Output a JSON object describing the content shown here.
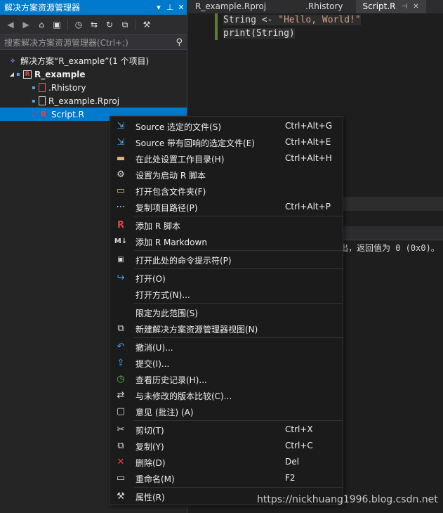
{
  "solution_explorer": {
    "title": "解决方案资源管理器",
    "title_controls": [
      "▾",
      "⊥",
      "✕"
    ],
    "search_placeholder": "搜索解决方案资源管理器(Ctrl+;)",
    "tree": {
      "solution": "解决方案“R_example”(1 个项目)",
      "project": "R_example",
      "files": [
        ".Rhistory",
        "R_example.Rproj",
        "Script.R"
      ]
    }
  },
  "editor": {
    "tabs": [
      "R_example.Rproj",
      ".Rhistory",
      "Script.R"
    ],
    "active_tab": "Script.R",
    "code": {
      "line1_prefix": "String <- ",
      "line1_string": "\"Hello, World!\"",
      "line2": "print(String)"
    }
  },
  "output": {
    "text": "出，返回值为 0 (0x0)。"
  },
  "context_menu": {
    "items": [
      {
        "label": "Source 选定的文件(S)",
        "shortcut": "Ctrl+Alt+G",
        "icon": "source-icon"
      },
      {
        "label": "Source 带有回响的选定文件(E)",
        "shortcut": "Ctrl+Alt+E",
        "icon": "source-echo-icon"
      },
      {
        "label": "在此处设置工作目录(H)",
        "shortcut": "Ctrl+Alt+H",
        "icon": "folder-icon"
      },
      {
        "label": "设置为启动 R 脚本",
        "shortcut": "",
        "icon": "gear-icon"
      },
      {
        "label": "打开包含文件夹(F)",
        "shortcut": "",
        "icon": "open-folder-icon"
      },
      {
        "label": "复制项目路径(P)",
        "shortcut": "Ctrl+Alt+P",
        "icon": "path-icon"
      },
      {
        "label": "添加 R 脚本",
        "shortcut": "",
        "icon": "r-script-icon"
      },
      {
        "label": "添加 R Markdown",
        "shortcut": "",
        "icon": "markdown-icon"
      },
      {
        "label": "打开此处的命令提示符(P)",
        "shortcut": "",
        "icon": "console-icon"
      },
      {
        "label": "打开(O)",
        "shortcut": "",
        "icon": "open-icon"
      },
      {
        "label": "打开方式(N)...",
        "shortcut": "",
        "icon": ""
      },
      {
        "label": "限定为此范围(S)",
        "shortcut": "",
        "icon": ""
      },
      {
        "label": "新建解决方案资源管理器视图(N)",
        "shortcut": "",
        "icon": "new-view-icon"
      },
      {
        "label": "撤消(U)...",
        "shortcut": "",
        "icon": "undo-icon"
      },
      {
        "label": "提交(I)...",
        "shortcut": "",
        "icon": "commit-icon"
      },
      {
        "label": "查看历史记录(H)...",
        "shortcut": "",
        "icon": "history-icon"
      },
      {
        "label": "与未修改的版本比较(C)...",
        "shortcut": "",
        "icon": "compare-icon"
      },
      {
        "label": "意见 (批注) (A)",
        "shortcut": "",
        "icon": "comment-icon"
      },
      {
        "label": "剪切(T)",
        "shortcut": "Ctrl+X",
        "icon": "cut-icon"
      },
      {
        "label": "复制(Y)",
        "shortcut": "Ctrl+C",
        "icon": "copy-icon"
      },
      {
        "label": "删除(D)",
        "shortcut": "Del",
        "icon": "delete-icon"
      },
      {
        "label": "重命名(M)",
        "shortcut": "F2",
        "icon": "rename-icon"
      },
      {
        "label": "属性(R)",
        "shortcut": "",
        "icon": "wrench-icon"
      }
    ]
  },
  "watermark": "https://nickhuang1996.blog.csdn.net",
  "colors": {
    "accent": "#007acc",
    "menu_bg": "#1b1b1c",
    "panel_bg": "#252526",
    "editor_bg": "#1e1e1e",
    "string": "#d69d85",
    "r_red": "#e04545"
  }
}
